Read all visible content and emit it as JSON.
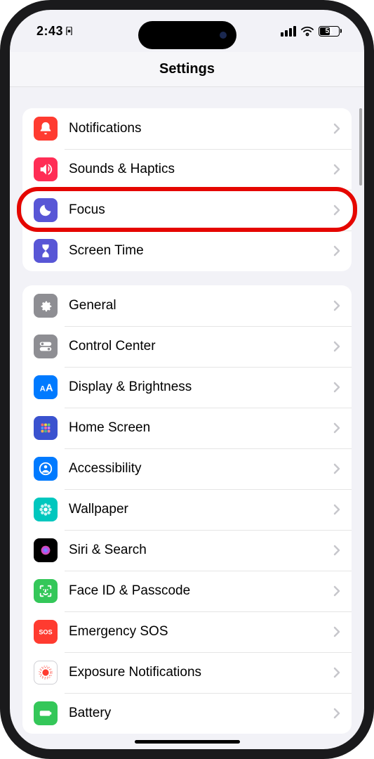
{
  "status": {
    "time": "2:43",
    "battery_pct": "51"
  },
  "header": {
    "title": "Settings"
  },
  "groups": [
    {
      "rows": [
        {
          "label": "Notifications",
          "icon": "bell",
          "color": "#ff3b30"
        },
        {
          "label": "Sounds & Haptics",
          "icon": "speaker",
          "color": "#ff2d55"
        },
        {
          "label": "Focus",
          "icon": "moon",
          "color": "#5856d6",
          "highlighted": true
        },
        {
          "label": "Screen Time",
          "icon": "hourglass",
          "color": "#5856d6"
        }
      ]
    },
    {
      "rows": [
        {
          "label": "General",
          "icon": "gear",
          "color": "#8e8e93"
        },
        {
          "label": "Control Center",
          "icon": "toggles",
          "color": "#8e8e93"
        },
        {
          "label": "Display & Brightness",
          "icon": "aa",
          "color": "#007aff"
        },
        {
          "label": "Home Screen",
          "icon": "grid",
          "color": "#3a52cf"
        },
        {
          "label": "Accessibility",
          "icon": "person-circle",
          "color": "#007aff"
        },
        {
          "label": "Wallpaper",
          "icon": "flower",
          "color": "#00c7be"
        },
        {
          "label": "Siri & Search",
          "icon": "siri",
          "color": "#000"
        },
        {
          "label": "Face ID & Passcode",
          "icon": "faceid",
          "color": "#34c759"
        },
        {
          "label": "Emergency SOS",
          "icon": "sos",
          "color": "#ff3b30"
        },
        {
          "label": "Exposure Notifications",
          "icon": "exposure",
          "color": "#fff",
          "border": true
        },
        {
          "label": "Battery",
          "icon": "battery",
          "color": "#34c759"
        }
      ]
    }
  ]
}
